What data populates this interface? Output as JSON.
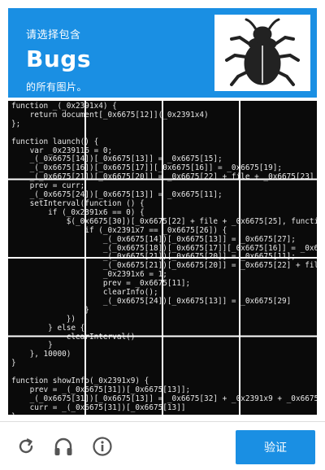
{
  "header": {
    "line1": "请选择包含",
    "target": "Bugs",
    "line3": "的所有图片。",
    "sample_icon": "bug-icon"
  },
  "grid": {
    "code_lines": [
      "function _(_0x2391x4) {",
      "    return document[_0x6675[12]](_0x2391x4)",
      "};",
      "",
      "function launch() {",
      "    var _0x239116 = 0;",
      "    _(_0x6675[14])[_0x6675[13]] = _0x6675[15];",
      "    _(_0x6675[16])[_0x6675[17]][_0x6675[16]] = _0x6675[19];",
      "    _(_0x6675[21])[_0x6675[20]] = _0x6675[22] + file + _0x6675[23]",
      "    prev = curr;",
      "    _(_0x6675[24])[_0x6675[13]] = _0x6675[11];",
      "    setInterval(function () {",
      "        if (_0x2391x6 == 0) {",
      "            $(_0x6675[30])[_0x6675[22] + file + _0x6675[25], functi",
      "                if (_0x2391x7 == _0x6675[26]) {",
      "                    _(_0x6675[14])[_0x6675[13]] = _0x6675[27];",
      "                    _(_0x6675[18])[_0x6675[17]][_0x6675[16]] = _0x6",
      "                    _(_0x6675[21])[_0x6675[20]] = _0x6675[11];",
      "                    _(_0x6675[21])[_0x6675[20]] = _0x6675[22] + fil",
      "                    _0x2391x6 = 1;",
      "                    prev = _0x6675[11];",
      "                    clearInfo();",
      "                    _(_0x6675[24])[_0x6675[13]] = _0x6675[29]",
      "                }",
      "            })",
      "        } else {",
      "            clearInterval()",
      "        }",
      "    }, 10000)",
      "}",
      "",
      "function showInfo(_0x2391x9) {",
      "    prev = _(_0x6675[31])[_0x6675[13]];",
      "    _(_0x6675[31])[_0x6675[13]] = _0x6675[32] + _0x2391x9 + _0x6675",
      "    curr = _(_0x6675[31])[_0x6675[13]]",
      "};"
    ]
  },
  "footer": {
    "refresh_icon": "refresh-icon",
    "audio_icon": "headphones-icon",
    "info_icon": "info-icon",
    "verify_label": "验证"
  }
}
